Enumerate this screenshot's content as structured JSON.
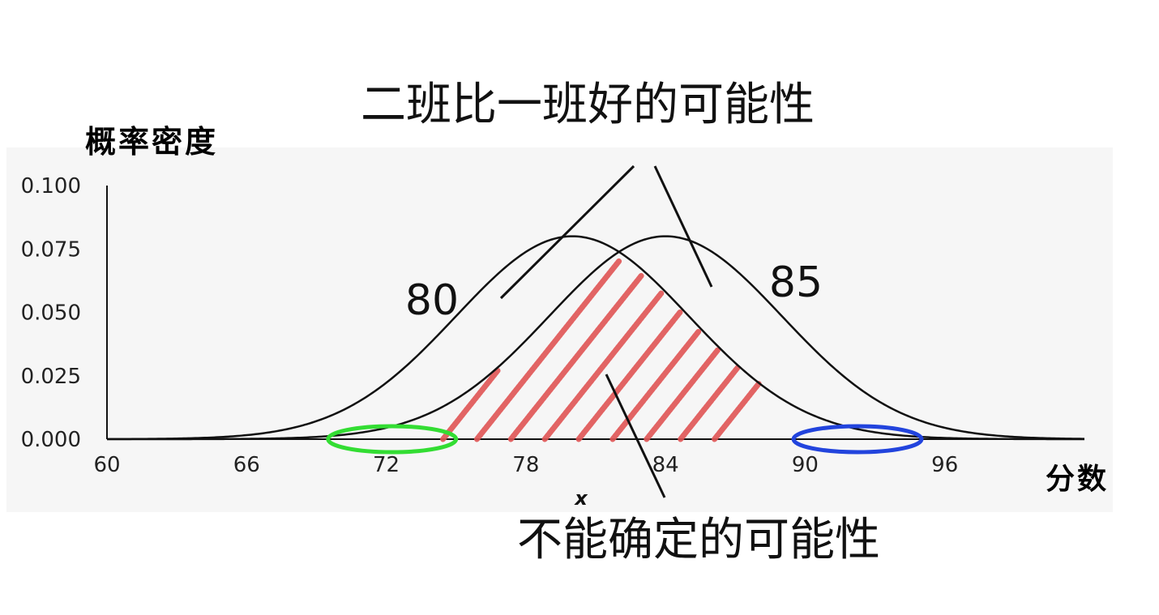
{
  "annotations": {
    "top_note": "二班比一班好的可能性",
    "bottom_note": "不能确定的可能性",
    "peak_label_left": "80",
    "peak_label_right": "85"
  },
  "chart_data": {
    "type": "line",
    "ylabel": "概率密度",
    "xlabel": "分数",
    "x_axis_letter": "x",
    "x_ticks": [
      "60",
      "66",
      "72",
      "78",
      "84",
      "90",
      "96"
    ],
    "y_ticks": [
      "0.000",
      "0.025",
      "0.050",
      "0.075",
      "0.100"
    ],
    "xlim": [
      60,
      102
    ],
    "ylim": [
      0,
      0.1
    ],
    "series": [
      {
        "mean": 80,
        "sd": 5,
        "peak_density": 0.08
      },
      {
        "mean": 84,
        "sd": 5,
        "peak_density": 0.08
      }
    ],
    "hatched_region": {
      "x_from": 74,
      "x_to": 88,
      "color": "#e05555"
    },
    "highlighted_tails": [
      {
        "x_from": 69.5,
        "x_to": 75,
        "color": "#33dd33"
      },
      {
        "x_from": 89.5,
        "x_to": 95,
        "color": "#2244dd"
      }
    ],
    "grid": false
  }
}
